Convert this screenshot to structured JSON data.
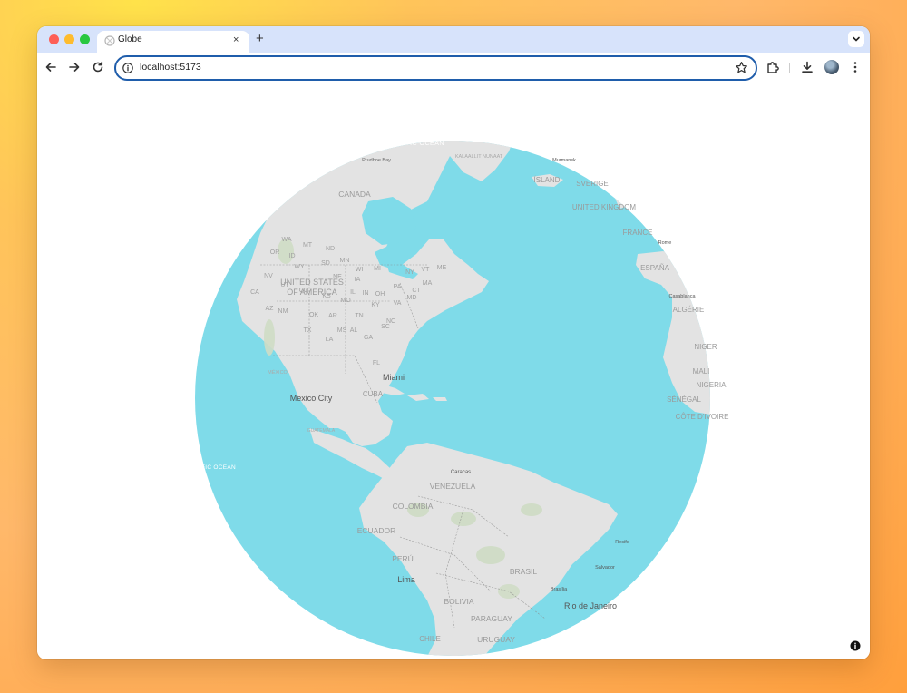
{
  "browser": {
    "tab_title": "Globe",
    "close_glyph": "×",
    "new_tab_glyph": "+",
    "url": "localhost:5173"
  },
  "map": {
    "colors": {
      "ocean": "#7fdbe9",
      "land": "#e3e3e3",
      "border": "#8a8a8a",
      "label": "#9a9a9a",
      "city": "#555555"
    },
    "labels": {
      "ocean_north": "IC OCEAN",
      "prudhoe": "Prudhoe Bay",
      "kalaallit": "KALAALLIT NUNAAT",
      "murmansk": "Murmansk",
      "island": "ÍSLAND",
      "sverige": "SVERIGE",
      "uk": "UNITED KINGDOM",
      "france": "FRANCE",
      "rome": "Rome",
      "espana": "ESPAÑA",
      "casablanca": "Casablanca",
      "algerie": "ALGÉRIE",
      "niger": "NIGER",
      "mali": "MALI",
      "nigeria": "NIGERIA",
      "senegal": "SÉNÉGAL",
      "cote": "CÔTE D'IVOIRE",
      "canada": "CANADA",
      "usa1": "UNITED STATES",
      "usa2": "OF AMERICA",
      "mexico": "MÉXICO",
      "miami": "Miami",
      "mexico_city": "Mexico City",
      "cuba": "CUBA",
      "guatemala": "GUATEMALA",
      "pacific": "FIC OCEAN",
      "caracas": "Caracas",
      "venezuela": "VENEZUELA",
      "colombia": "COLOMBIA",
      "ecuador": "ECUADOR",
      "peru": "PERÚ",
      "lima": "Lima",
      "brasil": "BRASIL",
      "brasilia": "Brasília",
      "bolivia": "BOLIVIA",
      "recife": "Recife",
      "salvador": "Salvador",
      "rio": "Rio de Janeiro",
      "paraguay": "PARAGUAY",
      "chile": "CHILE",
      "uruguay": "URUGUAY",
      "states": {
        "wa": "WA",
        "mt": "MT",
        "nd": "ND",
        "or": "OR",
        "id": "ID",
        "sd": "SD",
        "mn": "MN",
        "wy": "WY",
        "wi": "WI",
        "mi": "MI",
        "ny": "NY",
        "nv": "NV",
        "ne": "NE",
        "ia": "IA",
        "il": "IL",
        "in": "IN",
        "oh": "OH",
        "pa": "PA",
        "ut": "UT",
        "co": "CO",
        "ks": "KS",
        "mo": "MO",
        "ky": "KY",
        "va": "VA",
        "ca": "CA",
        "az": "AZ",
        "nm": "NM",
        "ok": "OK",
        "ar": "AR",
        "tn": "TN",
        "nc": "NC",
        "tx": "TX",
        "la": "LA",
        "ms": "MS",
        "al": "AL",
        "ga": "GA",
        "sc": "SC",
        "fl": "FL",
        "me": "ME",
        "vt": "VT",
        "ma": "MA",
        "ct": "CT",
        "md": "MD"
      }
    }
  }
}
